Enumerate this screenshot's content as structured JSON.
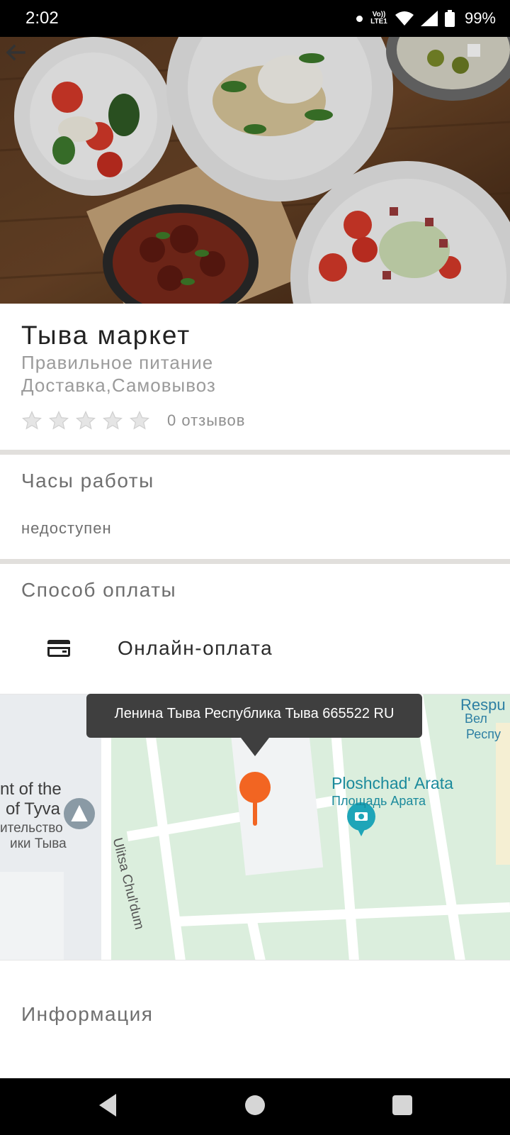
{
  "status_bar": {
    "time": "2:02",
    "network_label": "Vo)) LTE1",
    "battery": "99%"
  },
  "restaurant": {
    "name": "Тыва маркет",
    "category": "Правильное питание",
    "services": "Доставка,Самовывоз",
    "rating_stars": 0,
    "reviews": "0 отзывов"
  },
  "hours": {
    "title": "Часы работы",
    "value": "недоступен"
  },
  "payment": {
    "title": "Способ оплаты",
    "method": "Онлайн-оплата"
  },
  "map": {
    "tooltip": "Ленина Тыва Республика Тыва 665522 RU",
    "street_label": "Ulitsa Chul'dum",
    "poi_name": "Ploshchad' Arata",
    "poi_name_ru": "Площадь Арата",
    "left_label_line1": "nt of the",
    "left_label_line2": "of Tyva",
    "left_label_line3": "ительство",
    "left_label_line4": "ики Тыва",
    "right_label_line1": "Respu",
    "right_label_line2": "Вел",
    "right_label_line3": "Респу"
  },
  "info_section": {
    "title": "Информация"
  },
  "colors": {
    "accent_pin": "#f26522",
    "poi_teal": "#1ea5b8",
    "map_green": "#dbeedd"
  }
}
